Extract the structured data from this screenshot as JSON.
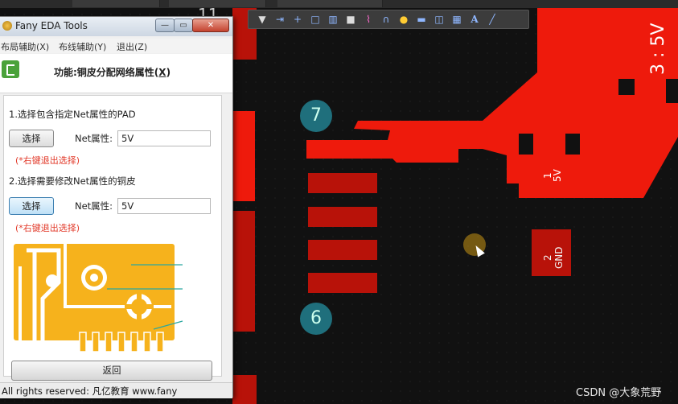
{
  "dialog": {
    "title": "Fany EDA Tools",
    "menu": [
      "布局辅助(X)",
      "布线辅助(Y)",
      "退出(Z)"
    ],
    "function_title_prefix": "功能:铜皮分配网络属性(",
    "function_title_key": "X",
    "function_title_suffix": ")",
    "step1": "1.选择包含指定Net属性的PAD",
    "step2": "2.选择需要修改Net属性的铜皮",
    "select_label": "选择",
    "net_label": "Net属性:",
    "net_value_1": "5V",
    "net_value_2": "5V",
    "hint": "(*右键退出选择)",
    "back_label": "返回",
    "status": "All rights reserved: 凡亿教育 www.fany"
  },
  "pcb": {
    "markers": [
      "7",
      "6"
    ],
    "silk_3_5v": "3 : 5V",
    "pad1_num": "1",
    "pad1_net": "5V",
    "pad2_num": "2",
    "pad2_net": "GND",
    "top_label": "11"
  },
  "watermark": "CSDN @大象荒野",
  "colors": {
    "copper": "#ee1a0c",
    "copper_dark": "#b81209",
    "marker": "#1f6f7c",
    "dialog_bg": "#f0f0f0",
    "hint": "#e23a2a"
  }
}
